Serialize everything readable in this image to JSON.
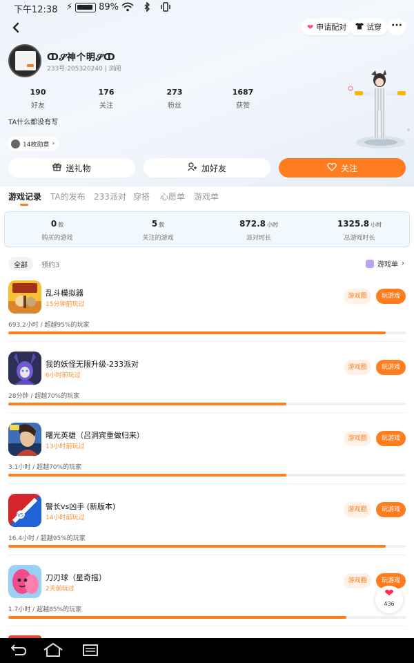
{
  "status_bar": {
    "time": "下午12:38",
    "battery": "89%"
  },
  "header": {
    "match_label": "申请配对",
    "tryon_label": "试穿"
  },
  "profile": {
    "nickname": "ↀ𝓢神个明𝓢ↀ",
    "uid_line": "233号:205320240 | 浏阅",
    "stats": [
      {
        "value": "190",
        "label": "好友"
      },
      {
        "value": "176",
        "label": "关注"
      },
      {
        "value": "273",
        "label": "粉丝"
      },
      {
        "value": "1687",
        "label": "获赞"
      }
    ],
    "bio": "TA什么都没有写",
    "medal_label": "14枚勋章"
  },
  "actions": {
    "gift": "送礼物",
    "add_friend": "加好友",
    "follow": "关注"
  },
  "tabs": [
    "游戏记录",
    "TA的发布",
    "233派对",
    "穿搭",
    "心愿单",
    "游戏单"
  ],
  "summary": [
    {
      "value": "0",
      "unit": "款",
      "label": "购买的游戏"
    },
    {
      "value": "5",
      "unit": "款",
      "label": "关注的游戏"
    },
    {
      "value": "872.8",
      "unit": "小时",
      "label": "派对时长"
    },
    {
      "value": "1325.8",
      "unit": "小时",
      "label": "总游戏时长"
    }
  ],
  "filters": {
    "all": "全部",
    "reserved": "预约3",
    "gamelist": "游戏单"
  },
  "games": [
    {
      "title": "乱斗模拟器",
      "when": "15分钟前玩过",
      "meta": "693.2小时 / 超越95%的玩家",
      "progress": 0.95,
      "circle": "游戏圈",
      "play": "玩游戏"
    },
    {
      "title": "我的妖怪无限升级-233派对",
      "when": "6小时前玩过",
      "meta": "28分钟 / 超越70%的玩家",
      "progress": 0.7,
      "circle": "游戏圈",
      "play": "玩游戏"
    },
    {
      "title": "曙光英雄（吕洞宾重做归来）",
      "when": "13小时前玩过",
      "meta": "3.1小时 / 超越70%的玩家",
      "progress": 0.7,
      "circle": "游戏圈",
      "play": "玩游戏"
    },
    {
      "title": "警长vs凶手 (新版本)",
      "when": "14小时前玩过",
      "meta": "16.4小时 / 超越95%的玩家",
      "progress": 0.95,
      "circle": "游戏圈",
      "play": "玩游戏"
    },
    {
      "title": "刀刃球（星奇摇）",
      "when": "2天前玩过",
      "meta": "1.7小时 / 超越85%的玩家",
      "progress": 0.85,
      "circle": "游戏圈",
      "play": "玩游戏"
    }
  ],
  "float_like_count": "436",
  "colors": {
    "accent": "#ff7d1e",
    "summary_bg": "#f2f9fe",
    "heart": "#ff2d55"
  }
}
